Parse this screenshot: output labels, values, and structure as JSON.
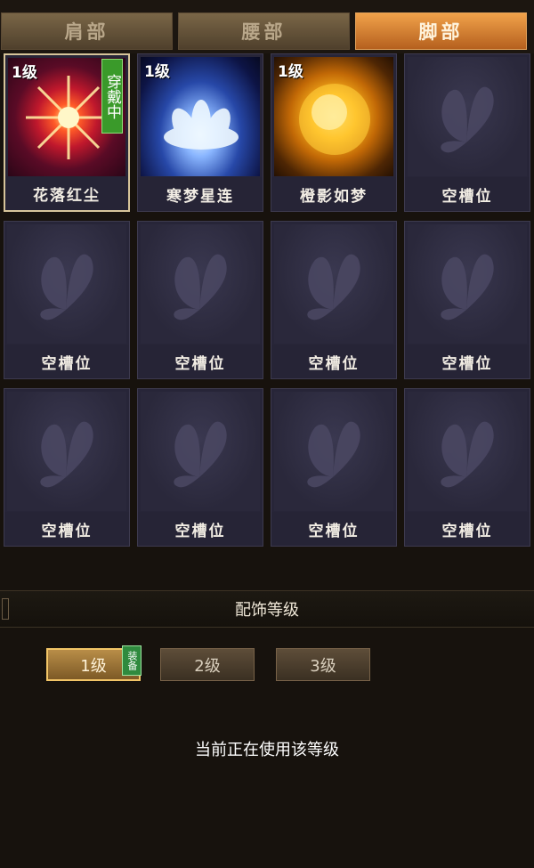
{
  "tabs": [
    {
      "label": "肩部",
      "active": false
    },
    {
      "label": "腰部",
      "active": false
    },
    {
      "label": "脚部",
      "active": true
    }
  ],
  "slots": [
    {
      "name": "花落红尘",
      "level": "1级",
      "wearing": "穿戴中",
      "art": "red-starburst",
      "selected": true
    },
    {
      "name": "寒梦星连",
      "level": "1级",
      "art": "blue-lotus"
    },
    {
      "name": "橙影如梦",
      "level": "1级",
      "art": "golden-sun"
    },
    {
      "name": "空槽位",
      "art": "butterfly-placeholder"
    },
    {
      "name": "空槽位",
      "art": "butterfly-placeholder"
    },
    {
      "name": "空槽位",
      "art": "butterfly-placeholder"
    },
    {
      "name": "空槽位",
      "art": "butterfly-placeholder"
    },
    {
      "name": "空槽位",
      "art": "butterfly-placeholder"
    },
    {
      "name": "空槽位",
      "art": "butterfly-placeholder"
    },
    {
      "name": "空槽位",
      "art": "butterfly-placeholder"
    },
    {
      "name": "空槽位",
      "art": "butterfly-placeholder"
    },
    {
      "name": "空槽位",
      "art": "butterfly-placeholder"
    }
  ],
  "section": {
    "title": "配饰等级"
  },
  "levels": [
    {
      "label": "1级",
      "active": true
    },
    {
      "label": "2级",
      "active": false
    },
    {
      "label": "3级",
      "active": false
    }
  ],
  "equip_badge": "装备",
  "status_text": "当前正在使用该等级",
  "colors": {
    "active_tab": "#d98a36",
    "wearing_badge": "#3a9a2a",
    "slot_bg": "#272538"
  }
}
